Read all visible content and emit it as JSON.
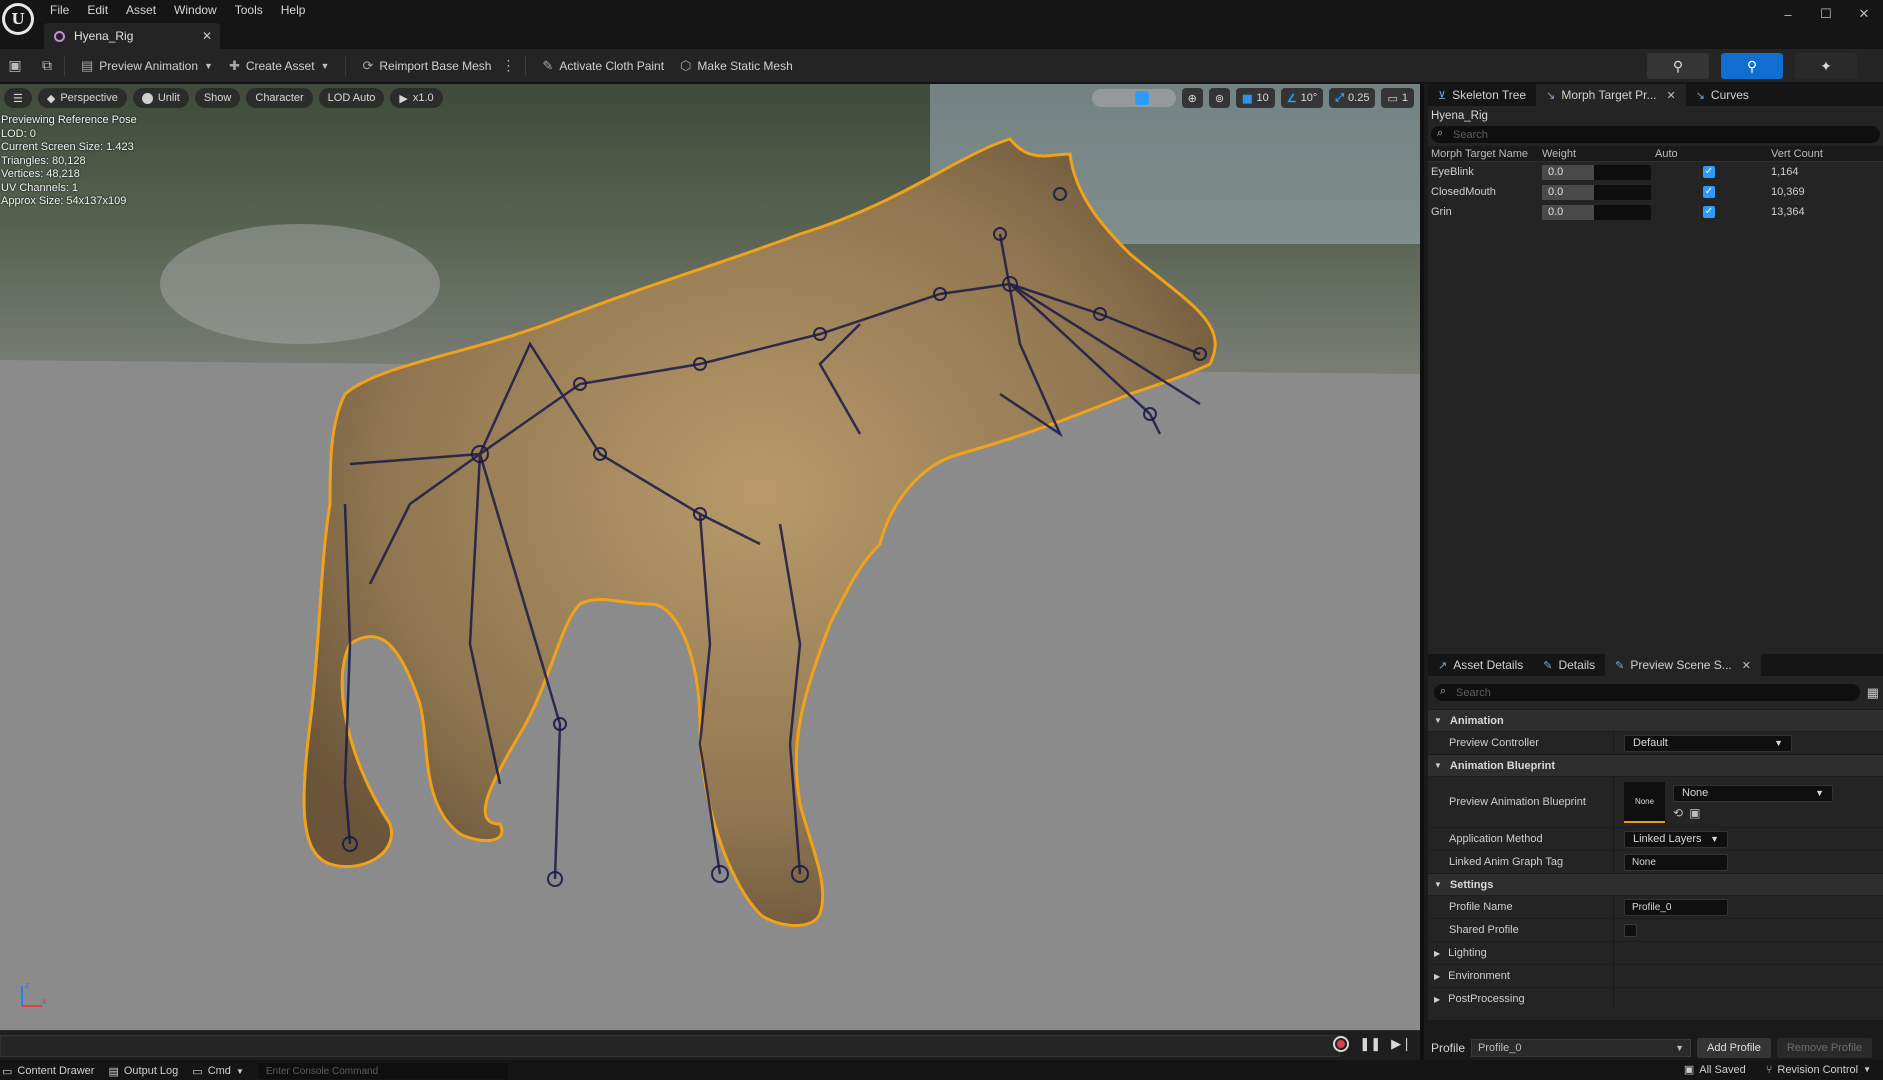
{
  "app": {
    "logo_letter": "U",
    "menu": [
      "File",
      "Edit",
      "Asset",
      "Window",
      "Tools",
      "Help"
    ],
    "window_controls": [
      "–",
      "☐",
      "✕"
    ],
    "document_tab": "Hyena_Rig"
  },
  "toolbar": {
    "preview_animation": "Preview Animation",
    "create_asset": "Create Asset",
    "reimport": "Reimport Base Mesh",
    "cloth_paint": "Activate Cloth Paint",
    "static_mesh": "Make Static Mesh"
  },
  "viewport": {
    "perspective": "Perspective",
    "unlit": "Unlit",
    "show": "Show",
    "character": "Character",
    "lod": "LOD Auto",
    "play_speed": "x1.0",
    "grid_snap": "10",
    "rot_snap": "10°",
    "scale_snap": "0.25",
    "camera_speed": "1",
    "info": [
      "Previewing Reference Pose",
      "LOD: 0",
      "Current Screen Size: 1.423",
      "Triangles: 80,128",
      "Vertices: 48,218",
      "UV Channels: 1",
      "Approx Size: 54x137x109"
    ],
    "axis_z": "z",
    "axis_x": "x"
  },
  "top_tabs": {
    "skeleton_tree": "Skeleton Tree",
    "morph_target": "Morph Target Pr...",
    "curves": "Curves"
  },
  "morph": {
    "asset_name": "Hyena_Rig",
    "search_placeholder": "Search",
    "columns": [
      "Morph Target Name",
      "Weight",
      "Auto",
      "Vert Count"
    ],
    "rows": [
      {
        "name": "EyeBlink",
        "weight": "0.0",
        "vert_count": "1,164"
      },
      {
        "name": "ClosedMouth",
        "weight": "0.0",
        "vert_count": "10,369"
      },
      {
        "name": "Grin",
        "weight": "0.0",
        "vert_count": "13,364"
      }
    ]
  },
  "bottom_tabs": {
    "asset_details": "Asset Details",
    "details": "Details",
    "preview_scene": "Preview Scene S..."
  },
  "details": {
    "search_placeholder": "Search",
    "cat_animation": "Animation",
    "preview_controller_label": "Preview Controller",
    "preview_controller_value": "Default",
    "cat_anim_bp": "Animation Blueprint",
    "preview_anim_bp_label": "Preview Animation Blueprint",
    "preview_anim_bp_thumb": "None",
    "preview_anim_bp_value": "None",
    "application_method_label": "Application Method",
    "application_method_value": "Linked Layers",
    "linked_tag_label": "Linked Anim Graph Tag",
    "linked_tag_value": "None",
    "cat_settings": "Settings",
    "profile_name_label": "Profile Name",
    "profile_name_value": "Profile_0",
    "shared_profile_label": "Shared Profile",
    "lighting": "Lighting",
    "environment": "Environment",
    "postprocessing": "PostProcessing"
  },
  "profile_bar": {
    "label": "Profile",
    "value": "Profile_0",
    "add": "Add Profile",
    "remove": "Remove Profile"
  },
  "status": {
    "content_drawer": "Content Drawer",
    "output_log": "Output Log",
    "cmd": "Cmd",
    "console_placeholder": "Enter Console Command",
    "saved": "All Saved",
    "revision": "Revision Control"
  }
}
